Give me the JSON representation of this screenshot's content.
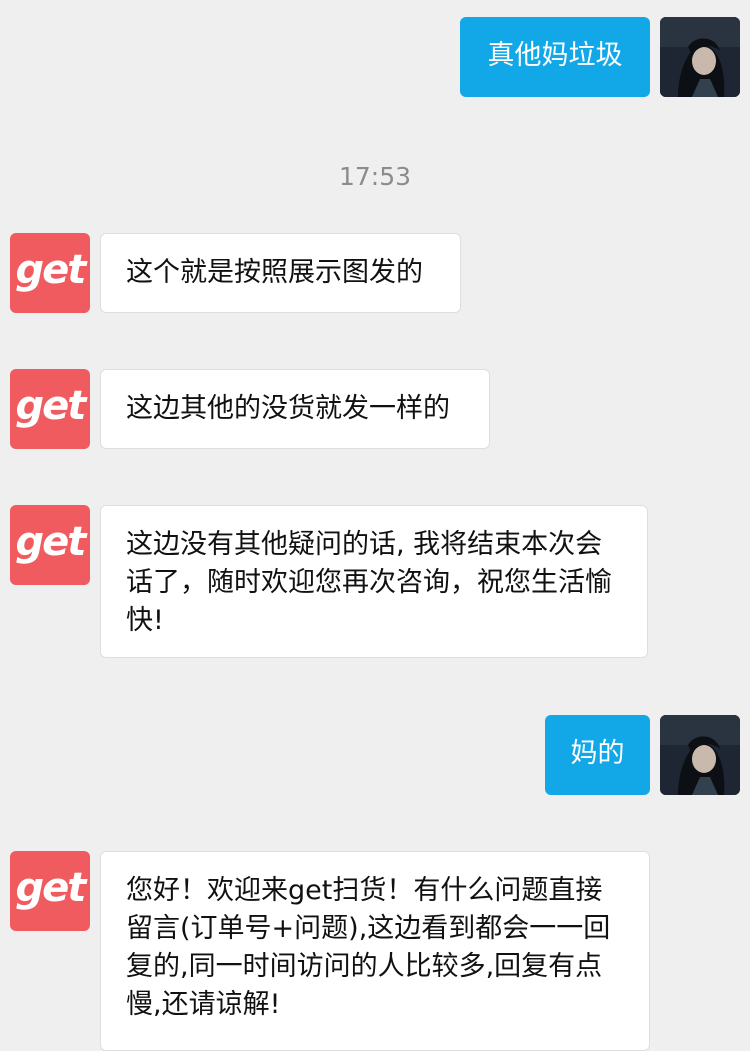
{
  "messages": [
    {
      "side": "user",
      "text": "真他妈垃圾"
    },
    {
      "side": "bot",
      "text": "这个就是按照展示图发的"
    },
    {
      "side": "bot",
      "text": "这边其他的没货就发一样的"
    },
    {
      "side": "bot",
      "text": "这边没有其他疑问的话, 我将结束本次会话了，随时欢迎您再次咨询，祝您生活愉快!"
    },
    {
      "side": "user",
      "text": "妈的"
    },
    {
      "side": "bot",
      "text": "您好！欢迎来get扫货！有什么问题直接留言(订单号+问题),这边看到都会一一回复的,同一时间访问的人比较多,回复有点慢,还请谅解!"
    }
  ],
  "timestamp": "17:53",
  "bot_avatar_text": "get",
  "colors": {
    "user_bubble": "#12a8e8",
    "bot_avatar": "#ef5b5f",
    "background": "#efefef"
  }
}
